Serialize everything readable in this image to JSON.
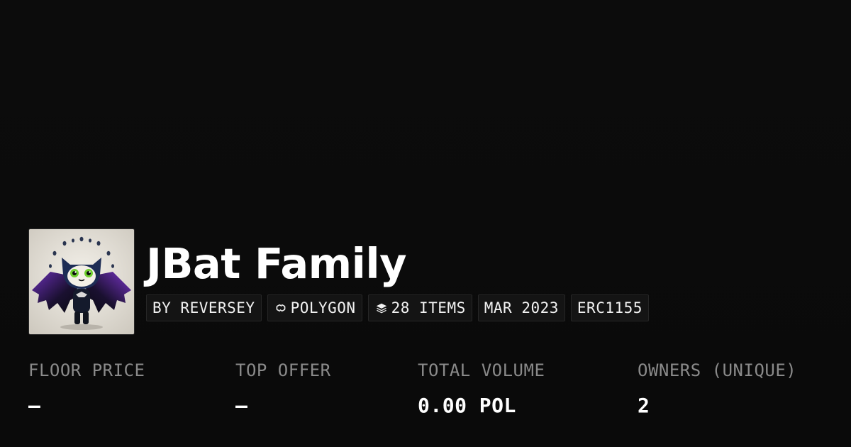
{
  "collection": {
    "name": "JBat Family",
    "avatar_icon": "bat-character-avatar"
  },
  "chips": {
    "creator": "BY REVERSEY",
    "chain": "POLYGON",
    "chain_icon": "polygon-chain-icon",
    "items": "28 ITEMS",
    "items_icon": "layers-icon",
    "date": "MAR 2023",
    "standard": "ERC1155"
  },
  "stats": {
    "floor_price": {
      "label": "FLOOR PRICE",
      "value": "–"
    },
    "top_offer": {
      "label": "TOP OFFER",
      "value": "–"
    },
    "total_volume": {
      "label": "TOTAL VOLUME",
      "value": "0.00 POL"
    },
    "owners": {
      "label": "OWNERS (UNIQUE)",
      "value": "2"
    }
  },
  "colors": {
    "background": "#0b0b0b",
    "chip_background": "#141414",
    "label_gray": "#8a8a8a",
    "text": "#ffffff"
  }
}
